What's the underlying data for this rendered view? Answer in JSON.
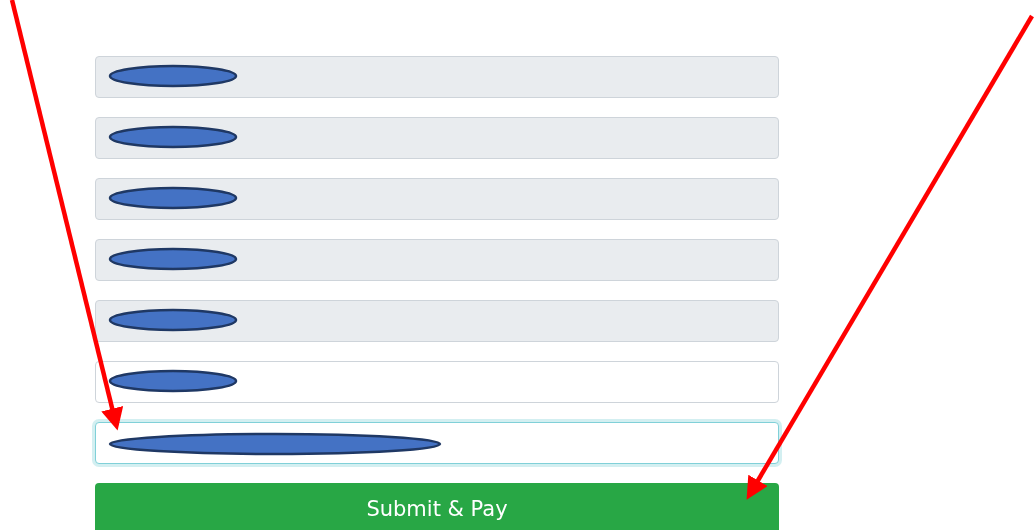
{
  "fields": [
    {
      "readonly": true,
      "focused": false,
      "wide_redaction": false
    },
    {
      "readonly": true,
      "focused": false,
      "wide_redaction": false
    },
    {
      "readonly": true,
      "focused": false,
      "wide_redaction": false
    },
    {
      "readonly": true,
      "focused": false,
      "wide_redaction": false
    },
    {
      "readonly": true,
      "focused": false,
      "wide_redaction": false
    },
    {
      "readonly": false,
      "focused": false,
      "wide_redaction": false
    },
    {
      "readonly": false,
      "focused": true,
      "wide_redaction": true
    }
  ],
  "submit_button": {
    "label": "Submit & Pay"
  },
  "annotations": [
    {
      "kind": "arrow"
    },
    {
      "kind": "arrow"
    }
  ]
}
